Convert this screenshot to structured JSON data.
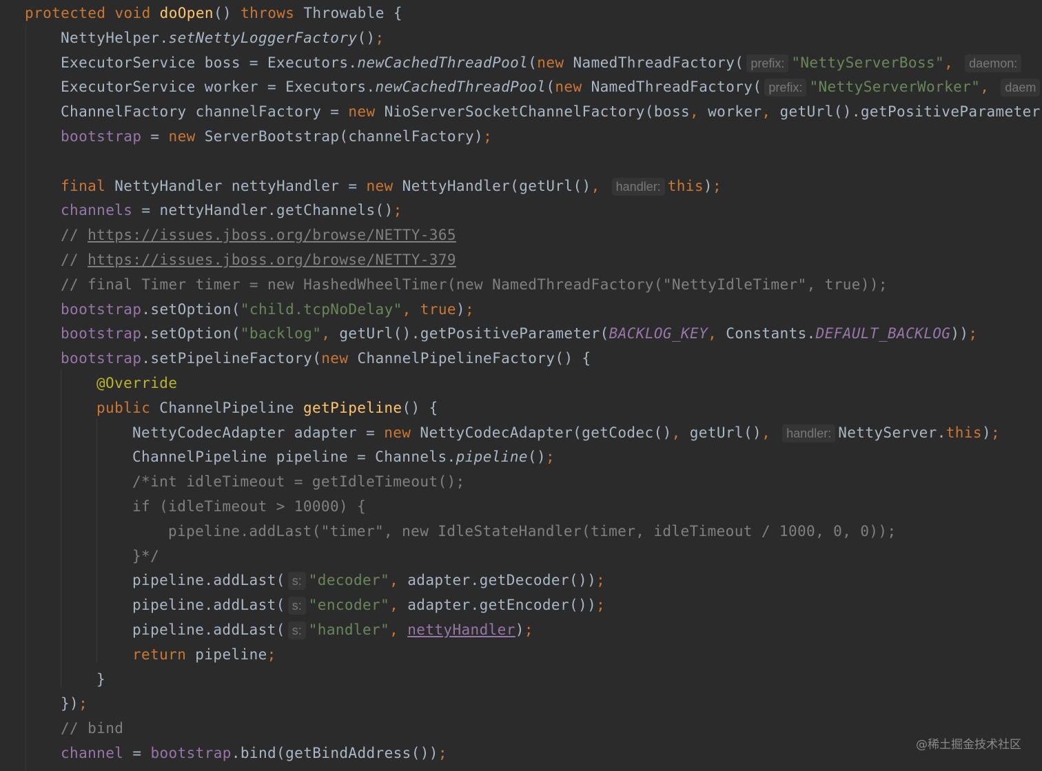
{
  "editor": {
    "lines": [
      {
        "indent": 0,
        "tokens": [
          {
            "t": "kw",
            "v": "protected"
          },
          {
            "t": "id",
            "v": " "
          },
          {
            "t": "kw",
            "v": "void"
          },
          {
            "t": "id",
            "v": " "
          },
          {
            "t": "fn",
            "v": "doOpen"
          },
          {
            "t": "id",
            "v": "() "
          },
          {
            "t": "kw",
            "v": "throws"
          },
          {
            "t": "id",
            "v": " Throwable {"
          }
        ]
      },
      {
        "indent": 1,
        "tokens": [
          {
            "t": "id",
            "v": "NettyHelper."
          },
          {
            "t": "sm",
            "v": "setNettyLoggerFactory"
          },
          {
            "t": "id",
            "v": "()"
          },
          {
            "t": "kw",
            "v": ";"
          }
        ]
      },
      {
        "indent": 1,
        "tokens": [
          {
            "t": "id",
            "v": "ExecutorService boss = Executors."
          },
          {
            "t": "sm",
            "v": "newCachedThreadPool"
          },
          {
            "t": "id",
            "v": "("
          },
          {
            "t": "kw",
            "v": "new"
          },
          {
            "t": "id",
            "v": " NamedThreadFactory("
          },
          {
            "t": "hint",
            "v": "prefix:"
          },
          {
            "t": "str",
            "v": "\"NettyServerBoss\""
          },
          {
            "t": "kw",
            "v": ", "
          },
          {
            "t": "hint",
            "v": "daemon:"
          }
        ]
      },
      {
        "indent": 1,
        "tokens": [
          {
            "t": "id",
            "v": "ExecutorService worker = Executors."
          },
          {
            "t": "sm",
            "v": "newCachedThreadPool"
          },
          {
            "t": "id",
            "v": "("
          },
          {
            "t": "kw",
            "v": "new"
          },
          {
            "t": "id",
            "v": " NamedThreadFactory("
          },
          {
            "t": "hint",
            "v": "prefix:"
          },
          {
            "t": "str",
            "v": "\"NettyServerWorker\""
          },
          {
            "t": "kw",
            "v": ", "
          },
          {
            "t": "hint",
            "v": "daem"
          }
        ]
      },
      {
        "indent": 1,
        "tokens": [
          {
            "t": "id",
            "v": "ChannelFactory channelFactory = "
          },
          {
            "t": "kw",
            "v": "new"
          },
          {
            "t": "id",
            "v": " NioServerSocketChannelFactory(boss"
          },
          {
            "t": "kw",
            "v": ", "
          },
          {
            "t": "id",
            "v": "worker"
          },
          {
            "t": "kw",
            "v": ", "
          },
          {
            "t": "id",
            "v": "getUrl().getPositiveParameter("
          }
        ]
      },
      {
        "indent": 1,
        "tokens": [
          {
            "t": "fld",
            "v": "bootstrap"
          },
          {
            "t": "id",
            "v": " = "
          },
          {
            "t": "kw",
            "v": "new"
          },
          {
            "t": "id",
            "v": " ServerBootstrap(channelFactory)"
          },
          {
            "t": "kw",
            "v": ";"
          }
        ]
      },
      {
        "indent": 0,
        "tokens": []
      },
      {
        "indent": 1,
        "tokens": [
          {
            "t": "kw",
            "v": "final"
          },
          {
            "t": "id",
            "v": " NettyHandler nettyHandler = "
          },
          {
            "t": "kw",
            "v": "new"
          },
          {
            "t": "id",
            "v": " NettyHandler(getUrl()"
          },
          {
            "t": "kw",
            "v": ", "
          },
          {
            "t": "hint",
            "v": "handler:"
          },
          {
            "t": "kw",
            "v": "this"
          },
          {
            "t": "id",
            "v": ")"
          },
          {
            "t": "kw",
            "v": ";"
          }
        ]
      },
      {
        "indent": 1,
        "tokens": [
          {
            "t": "fld",
            "v": "channels"
          },
          {
            "t": "id",
            "v": " = nettyHandler.getChannels()"
          },
          {
            "t": "kw",
            "v": ";"
          }
        ]
      },
      {
        "indent": 1,
        "tokens": [
          {
            "t": "cm",
            "v": "// "
          },
          {
            "t": "lnk",
            "v": "https://issues.jboss.org/browse/NETTY-365"
          }
        ]
      },
      {
        "indent": 1,
        "tokens": [
          {
            "t": "cm",
            "v": "// "
          },
          {
            "t": "lnk",
            "v": "https://issues.jboss.org/browse/NETTY-379"
          }
        ]
      },
      {
        "indent": 1,
        "tokens": [
          {
            "t": "cm",
            "v": "// final Timer timer = new HashedWheelTimer(new NamedThreadFactory(\"NettyIdleTimer\", true));"
          }
        ]
      },
      {
        "indent": 1,
        "tokens": [
          {
            "t": "fld",
            "v": "bootstrap"
          },
          {
            "t": "id",
            "v": ".setOption("
          },
          {
            "t": "str",
            "v": "\"child.tcpNoDelay\""
          },
          {
            "t": "kw",
            "v": ", true"
          },
          {
            "t": "id",
            "v": ")"
          },
          {
            "t": "kw",
            "v": ";"
          }
        ]
      },
      {
        "indent": 1,
        "tokens": [
          {
            "t": "fld",
            "v": "bootstrap"
          },
          {
            "t": "id",
            "v": ".setOption("
          },
          {
            "t": "str",
            "v": "\"backlog\""
          },
          {
            "t": "kw",
            "v": ", "
          },
          {
            "t": "id",
            "v": "getUrl().getPositiveParameter("
          },
          {
            "t": "cst",
            "v": "BACKLOG_KEY"
          },
          {
            "t": "kw",
            "v": ", "
          },
          {
            "t": "id",
            "v": "Constants."
          },
          {
            "t": "cst",
            "v": "DEFAULT_BACKLOG"
          },
          {
            "t": "id",
            "v": "))"
          },
          {
            "t": "kw",
            "v": ";"
          }
        ]
      },
      {
        "indent": 1,
        "tokens": [
          {
            "t": "fld",
            "v": "bootstrap"
          },
          {
            "t": "id",
            "v": ".setPipelineFactory("
          },
          {
            "t": "kw",
            "v": "new"
          },
          {
            "t": "id",
            "v": " ChannelPipelineFactory() {"
          }
        ]
      },
      {
        "indent": 2,
        "tokens": [
          {
            "t": "ann",
            "v": "@Override"
          }
        ]
      },
      {
        "indent": 2,
        "tokens": [
          {
            "t": "kw",
            "v": "public"
          },
          {
            "t": "id",
            "v": " ChannelPipeline "
          },
          {
            "t": "fn",
            "v": "getPipeline"
          },
          {
            "t": "id",
            "v": "() {"
          }
        ]
      },
      {
        "indent": 3,
        "tokens": [
          {
            "t": "id",
            "v": "NettyCodecAdapter adapter = "
          },
          {
            "t": "kw",
            "v": "new"
          },
          {
            "t": "id",
            "v": " NettyCodecAdapter(getCodec()"
          },
          {
            "t": "kw",
            "v": ", "
          },
          {
            "t": "id",
            "v": "getUrl()"
          },
          {
            "t": "kw",
            "v": ", "
          },
          {
            "t": "hint",
            "v": "handler:"
          },
          {
            "t": "id",
            "v": "NettyServer."
          },
          {
            "t": "kw",
            "v": "this"
          },
          {
            "t": "id",
            "v": ")"
          },
          {
            "t": "kw",
            "v": ";"
          }
        ]
      },
      {
        "indent": 3,
        "tokens": [
          {
            "t": "id",
            "v": "ChannelPipeline pipeline = Channels."
          },
          {
            "t": "sm",
            "v": "pipeline"
          },
          {
            "t": "id",
            "v": "()"
          },
          {
            "t": "kw",
            "v": ";"
          }
        ]
      },
      {
        "indent": 3,
        "tokens": [
          {
            "t": "cm",
            "v": "/*int idleTimeout = getIdleTimeout();"
          }
        ]
      },
      {
        "indent": 3,
        "tokens": [
          {
            "t": "cm",
            "v": "if (idleTimeout > 10000) {"
          }
        ]
      },
      {
        "indent": 4,
        "tokens": [
          {
            "t": "cm",
            "v": "pipeline.addLast(\"timer\", new IdleStateHandler(timer, idleTimeout / 1000, 0, 0));"
          }
        ]
      },
      {
        "indent": 3,
        "tokens": [
          {
            "t": "cm",
            "v": "}*/"
          }
        ]
      },
      {
        "indent": 3,
        "tokens": [
          {
            "t": "id",
            "v": "pipeline.addLast("
          },
          {
            "t": "hint",
            "v": "s:"
          },
          {
            "t": "str",
            "v": "\"decoder\""
          },
          {
            "t": "kw",
            "v": ", "
          },
          {
            "t": "id",
            "v": "adapter.getDecoder())"
          },
          {
            "t": "kw",
            "v": ";"
          }
        ]
      },
      {
        "indent": 3,
        "tokens": [
          {
            "t": "id",
            "v": "pipeline.addLast("
          },
          {
            "t": "hint",
            "v": "s:"
          },
          {
            "t": "str",
            "v": "\"encoder\""
          },
          {
            "t": "kw",
            "v": ", "
          },
          {
            "t": "id",
            "v": "adapter.getEncoder())"
          },
          {
            "t": "kw",
            "v": ";"
          }
        ]
      },
      {
        "indent": 3,
        "tokens": [
          {
            "t": "id",
            "v": "pipeline.addLast("
          },
          {
            "t": "hint",
            "v": "s:"
          },
          {
            "t": "str",
            "v": "\"handler\""
          },
          {
            "t": "kw",
            "v": ", "
          },
          {
            "t": "fldu",
            "v": "nettyHandler"
          },
          {
            "t": "id",
            "v": ")"
          },
          {
            "t": "kw",
            "v": ";"
          }
        ]
      },
      {
        "indent": 3,
        "tokens": [
          {
            "t": "kw",
            "v": "return"
          },
          {
            "t": "id",
            "v": " pipeline"
          },
          {
            "t": "kw",
            "v": ";"
          }
        ]
      },
      {
        "indent": 2,
        "tokens": [
          {
            "t": "id",
            "v": "}"
          }
        ]
      },
      {
        "indent": 1,
        "tokens": [
          {
            "t": "id",
            "v": "})"
          },
          {
            "t": "kw",
            "v": ";"
          }
        ]
      },
      {
        "indent": 1,
        "tokens": [
          {
            "t": "cm",
            "v": "// bind"
          }
        ]
      },
      {
        "indent": 1,
        "tokens": [
          {
            "t": "fld",
            "v": "channel"
          },
          {
            "t": "id",
            "v": " = "
          },
          {
            "t": "fld",
            "v": "bootstrap"
          },
          {
            "t": "id",
            "v": ".bind(getBindAddress())"
          },
          {
            "t": "kw",
            "v": ";"
          }
        ]
      },
      {
        "indent": 0,
        "tokens": [
          {
            "t": "id",
            "v": "}"
          }
        ]
      }
    ]
  },
  "watermark": "@稀土掘金技术社区",
  "colors": {
    "background": "#2b2b2b",
    "keyword": "#cc7832",
    "function_decl": "#ffc66d",
    "identifier": "#a9b7c6",
    "string": "#6a8759",
    "field": "#9876aa",
    "comment": "#808080",
    "annotation": "#bbb529",
    "inlay_hint_bg": "#353535",
    "inlay_hint_fg": "#787878"
  }
}
